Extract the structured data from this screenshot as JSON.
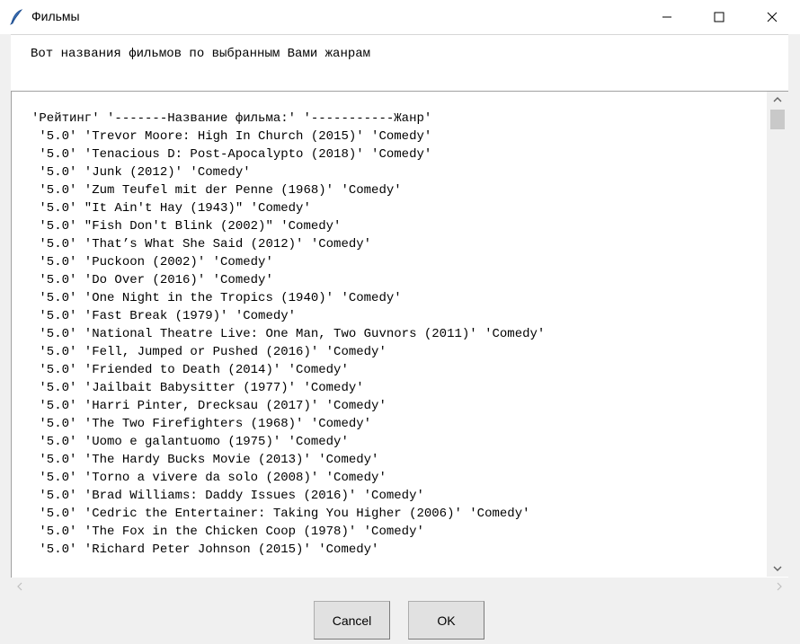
{
  "window": {
    "title": "Фильмы",
    "icon": "feather-icon"
  },
  "header": {
    "text": "Вот названия фильмов по выбранным Вами жанрам"
  },
  "list": {
    "lines": [
      "'Рейтинг' '-------Название фильма:' '-----------Жанр'",
      " '5.0' 'Trevor Moore: High In Church (2015)' 'Comedy'",
      " '5.0' 'Tenacious D: Post-Apocalypto (2018)' 'Comedy'",
      " '5.0' 'Junk (2012)' 'Comedy'",
      " '5.0' 'Zum Teufel mit der Penne (1968)' 'Comedy'",
      " '5.0' \"It Ain't Hay (1943)\" 'Comedy'",
      " '5.0' \"Fish Don't Blink (2002)\" 'Comedy'",
      " '5.0' 'That’s What She Said (2012)' 'Comedy'",
      " '5.0' 'Puckoon (2002)' 'Comedy'",
      " '5.0' 'Do Over (2016)' 'Comedy'",
      " '5.0' 'One Night in the Tropics (1940)' 'Comedy'",
      " '5.0' 'Fast Break (1979)' 'Comedy'",
      " '5.0' 'National Theatre Live: One Man, Two Guvnors (2011)' 'Comedy'",
      " '5.0' 'Fell, Jumped or Pushed (2016)' 'Comedy'",
      " '5.0' 'Friended to Death (2014)' 'Comedy'",
      " '5.0' 'Jailbait Babysitter (1977)' 'Comedy'",
      " '5.0' 'Harri Pinter, Drecksau (2017)' 'Comedy'",
      " '5.0' 'The Two Firefighters (1968)' 'Comedy'",
      " '5.0' 'Uomo e galantuomo (1975)' 'Comedy'",
      " '5.0' 'The Hardy Bucks Movie (2013)' 'Comedy'",
      " '5.0' 'Torno a vivere da solo (2008)' 'Comedy'",
      " '5.0' 'Brad Williams: Daddy Issues (2016)' 'Comedy'",
      " '5.0' 'Cedric the Entertainer: Taking You Higher (2006)' 'Comedy'",
      " '5.0' 'The Fox in the Chicken Coop (1978)' 'Comedy'",
      " '5.0' 'Richard Peter Johnson (2015)' 'Comedy'"
    ]
  },
  "buttons": {
    "cancel": "Cancel",
    "ok": "OK"
  }
}
